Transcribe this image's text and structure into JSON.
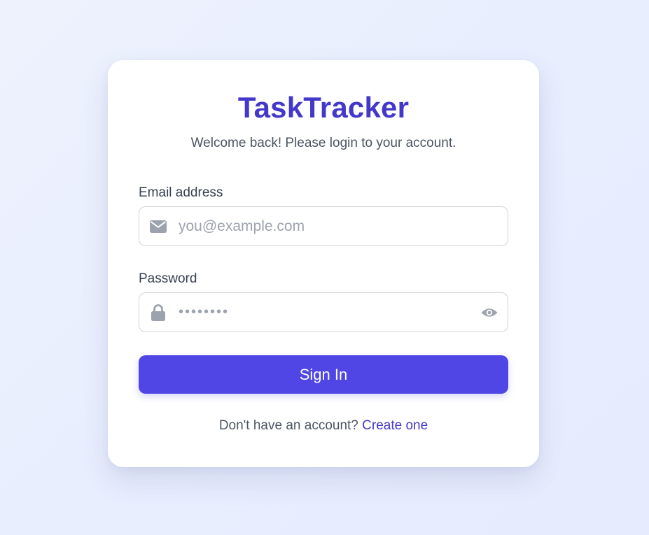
{
  "app": {
    "title": "TaskTracker",
    "subtitle": "Welcome back! Please login to your account."
  },
  "form": {
    "email": {
      "label": "Email address",
      "placeholder": "you@example.com",
      "value": "",
      "icon": "envelope-icon"
    },
    "password": {
      "label": "Password",
      "value": "••••••••",
      "icon": "lock-icon",
      "toggle_icon": "eye-icon"
    },
    "submit_label": "Sign In"
  },
  "footer": {
    "prompt": "Don't have an account?",
    "link_label": "Create one"
  },
  "colors": {
    "brand": "#4338ca",
    "button": "#4f46e5",
    "background": "#e8eefe",
    "icon": "#9ca3af"
  }
}
